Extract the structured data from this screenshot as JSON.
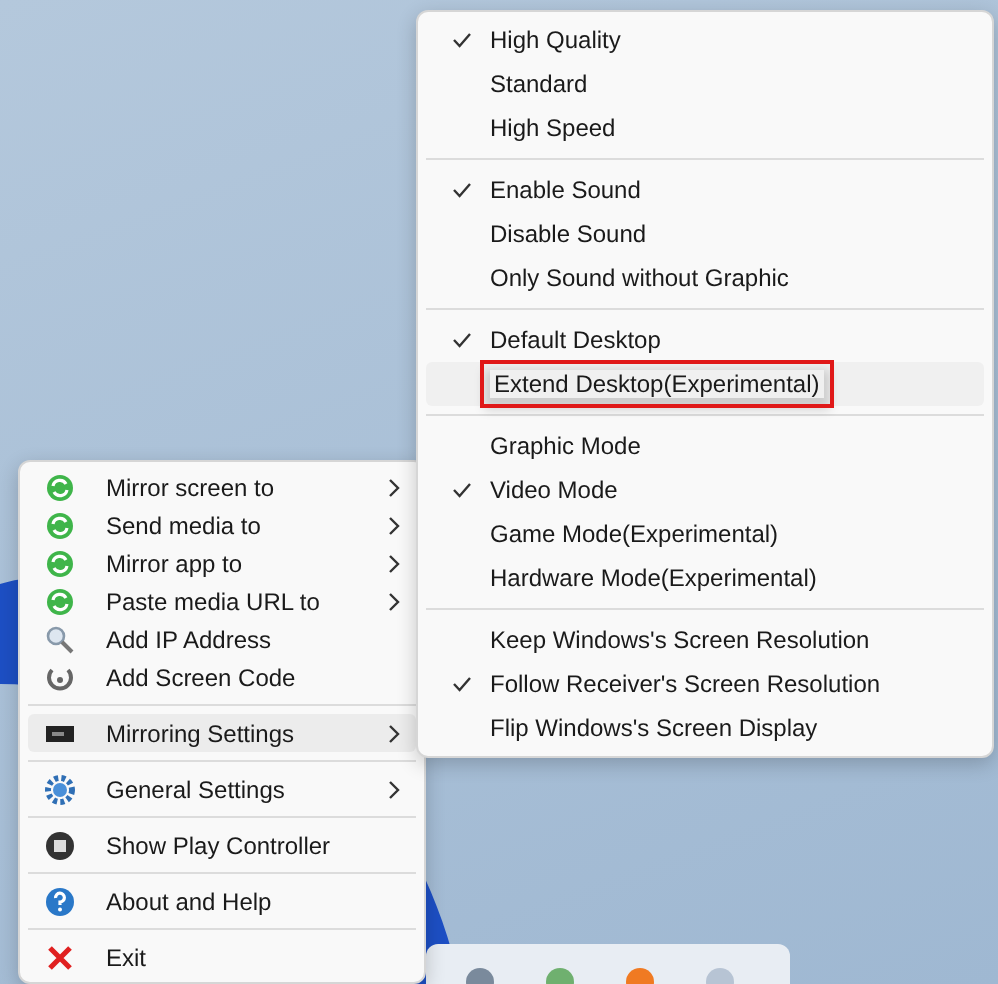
{
  "main_menu": {
    "groups": [
      [
        {
          "label": "Mirror screen to",
          "kind": "sync",
          "submenu": true,
          "selected": false
        },
        {
          "label": "Send media to",
          "kind": "sync",
          "submenu": true,
          "selected": false
        },
        {
          "label": "Mirror app to",
          "kind": "sync",
          "submenu": true,
          "selected": false
        },
        {
          "label": "Paste media URL to",
          "kind": "sync",
          "submenu": true,
          "selected": false
        },
        {
          "label": "Add IP Address",
          "kind": "search",
          "submenu": false,
          "selected": false
        },
        {
          "label": "Add Screen Code",
          "kind": "refresh",
          "submenu": false,
          "selected": false
        }
      ],
      [
        {
          "label": "Mirroring Settings",
          "kind": "monitor",
          "submenu": true,
          "selected": true
        }
      ],
      [
        {
          "label": "General Settings",
          "kind": "gear",
          "submenu": true,
          "selected": false
        }
      ],
      [
        {
          "label": "Show Play Controller",
          "kind": "stop",
          "submenu": false,
          "selected": false
        }
      ],
      [
        {
          "label": "About and Help",
          "kind": "help",
          "submenu": false,
          "selected": false
        }
      ],
      [
        {
          "label": "Exit",
          "kind": "close",
          "submenu": false,
          "selected": false
        }
      ]
    ]
  },
  "submenu": {
    "groups": [
      [
        {
          "label": "High Quality",
          "checked": true,
          "annotated": false
        },
        {
          "label": "Standard",
          "checked": false,
          "annotated": false
        },
        {
          "label": "High Speed",
          "checked": false,
          "annotated": false
        }
      ],
      [
        {
          "label": "Enable Sound",
          "checked": true,
          "annotated": false
        },
        {
          "label": "Disable Sound",
          "checked": false,
          "annotated": false
        },
        {
          "label": "Only Sound without Graphic",
          "checked": false,
          "annotated": false
        }
      ],
      [
        {
          "label": "Default Desktop",
          "checked": true,
          "annotated": false
        },
        {
          "label": "Extend Desktop(Experimental)",
          "checked": false,
          "annotated": true
        }
      ],
      [
        {
          "label": "Graphic Mode",
          "checked": false,
          "annotated": false
        },
        {
          "label": "Video Mode",
          "checked": true,
          "annotated": false
        },
        {
          "label": "Game Mode(Experimental)",
          "checked": false,
          "annotated": false
        },
        {
          "label": "Hardware Mode(Experimental)",
          "checked": false,
          "annotated": false
        }
      ],
      [
        {
          "label": "Keep Windows's Screen Resolution",
          "checked": false,
          "annotated": false
        },
        {
          "label": "Follow Receiver's Screen Resolution",
          "checked": true,
          "annotated": false
        },
        {
          "label": "Flip Windows's Screen Display",
          "checked": false,
          "annotated": false
        }
      ]
    ]
  }
}
